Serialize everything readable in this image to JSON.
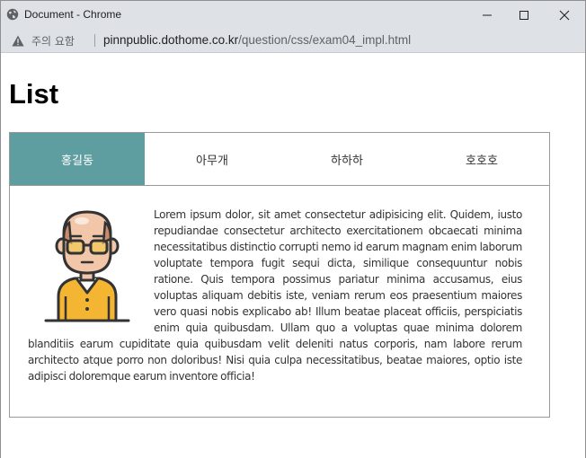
{
  "window": {
    "title": "Document - Chrome",
    "minimize_label": "minimize",
    "maximize_label": "maximize",
    "close_label": "close"
  },
  "address_bar": {
    "security_text": "주의 요함",
    "url_host": "pinnpublic.dothome.co.kr",
    "url_path": "/question/css/exam04_impl.html"
  },
  "page": {
    "heading": "List",
    "tabs": [
      {
        "label": "홍길동",
        "active": true
      },
      {
        "label": "아무개",
        "active": false
      },
      {
        "label": "하하하",
        "active": false
      },
      {
        "label": "호호호",
        "active": false
      }
    ],
    "body_text": "Lorem ipsum dolor, sit amet consectetur adipisicing elit. Quidem, iusto repudiandae consectetur architecto exercitationem obcaecati minima necessitatibus distinctio corrupti nemo id earum magnam enim laborum voluptate tempora fugit sequi dicta, similique consequuntur nobis ratione. Quis tempora possimus pariatur minima accusamus, eius voluptas aliquam debitis iste, veniam rerum eos praesentium maiores vero quasi nobis explicabo ab! Illum beatae placeat officiis, perspiciatis enim quia quibusdam. Ullam quo a voluptas quae minima dolorem blanditiis earum cupiditate quia quibusdam velit deleniti natus corporis, nam labore rerum architecto atque porro non doloribus! Nisi quia culpa necessitatibus, beatae maiores, optio iste adipisci doloremque earum inventore officia!"
  },
  "colors": {
    "active_tab": "#5f9ea0",
    "titlebar": "#dee1e6",
    "border": "#999999"
  }
}
